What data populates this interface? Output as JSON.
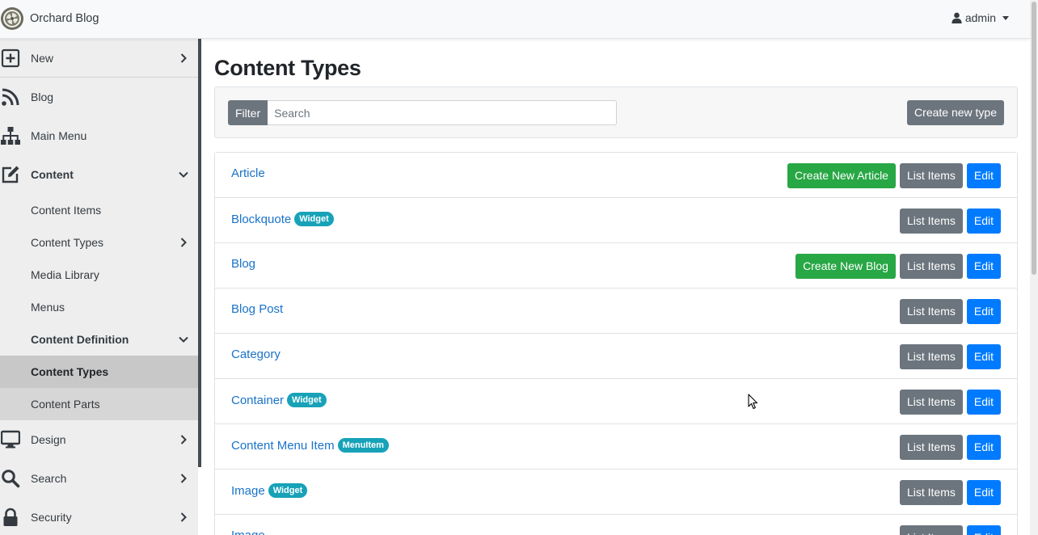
{
  "navbar": {
    "brand": "Orchard Blog",
    "user": "admin"
  },
  "sidebar": {
    "new": "New",
    "blog": "Blog",
    "main_menu": "Main Menu",
    "content": "Content",
    "content_items": "Content Items",
    "content_types": "Content Types",
    "media_library": "Media Library",
    "menus": "Menus",
    "content_definition": "Content Definition",
    "def_content_types": "Content Types",
    "content_parts": "Content Parts",
    "design": "Design",
    "search": "Search",
    "security": "Security"
  },
  "main": {
    "title": "Content Types",
    "filter_label": "Filter",
    "search_placeholder": "Search",
    "create_type_label": "Create new type"
  },
  "actions": {
    "list_items": "List Items",
    "edit": "Edit"
  },
  "types": [
    {
      "name": "Article",
      "badge": "",
      "create": "Create New Article"
    },
    {
      "name": "Blockquote",
      "badge": "Widget",
      "create": ""
    },
    {
      "name": "Blog",
      "badge": "",
      "create": "Create New Blog"
    },
    {
      "name": "Blog Post",
      "badge": "",
      "create": ""
    },
    {
      "name": "Category",
      "badge": "",
      "create": ""
    },
    {
      "name": "Container",
      "badge": "Widget",
      "create": ""
    },
    {
      "name": "Content Menu Item",
      "badge": "MenuItem",
      "create": ""
    },
    {
      "name": "Image",
      "badge": "Widget",
      "create": ""
    },
    {
      "name": "Image",
      "badge": "",
      "create": ""
    }
  ],
  "colors": {
    "primary": "#007bff",
    "secondary": "#6c757d",
    "success": "#28a745",
    "info": "#17a2b8",
    "link": "#1a73c8",
    "sidebar_bg": "#eeeeee",
    "sidebar_active": "#c8c8c8"
  },
  "icons": {
    "new": "plus-square-icon",
    "blog": "rss-icon",
    "main_menu": "sitemap-icon",
    "content": "edit-icon",
    "design": "desktop-icon",
    "search": "search-icon",
    "security": "lock-icon"
  }
}
